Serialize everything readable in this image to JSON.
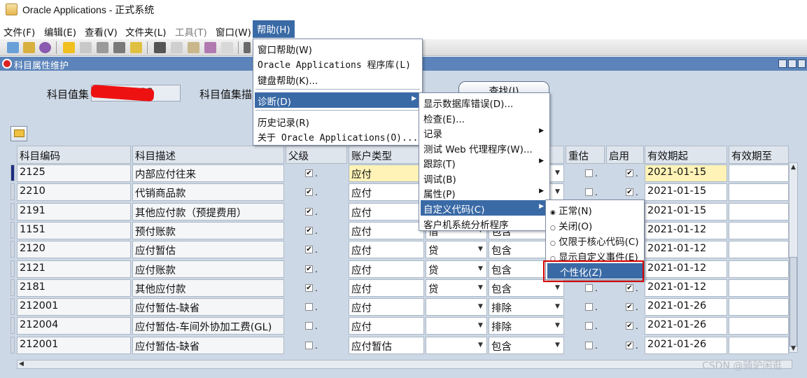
{
  "window": {
    "title": "Oracle Applications - 正式系统"
  },
  "menubar": {
    "items": [
      {
        "label": "文件(F)",
        "enabled": true
      },
      {
        "label": "编辑(E)",
        "enabled": true
      },
      {
        "label": "查看(V)",
        "enabled": true
      },
      {
        "label": "文件夹(L)",
        "enabled": true
      },
      {
        "label": "工具(T)",
        "enabled": false
      },
      {
        "label": "窗口(W)",
        "enabled": true
      },
      {
        "label": "帮助(H)",
        "enabled": true,
        "open": true
      }
    ]
  },
  "form": {
    "title": "科目属性维护",
    "value_set_label": "科目值集",
    "value_set_value": "ACC",
    "value_set_desc_label": "科目值集描",
    "find_label": "查找(I)"
  },
  "grid": {
    "headers": [
      "科目编码",
      "科目描述",
      "父级",
      "账户类型",
      "",
      "",
      "重估",
      "启用",
      "有效期起",
      "有效期至"
    ],
    "rows": [
      {
        "code": "2125",
        "desc": "内部应付往来",
        "parent": true,
        "type": "应付",
        "dc": "",
        "inc": "",
        "reval": false,
        "enabled": true,
        "start": "2021-01-15",
        "end": ""
      },
      {
        "code": "2210",
        "desc": "代销商品款",
        "parent": true,
        "type": "应付",
        "dc": "",
        "inc": "",
        "reval": false,
        "enabled": true,
        "start": "2021-01-15",
        "end": ""
      },
      {
        "code": "2191",
        "desc": "其他应付款（预提费用）",
        "parent": true,
        "type": "应付",
        "dc": "",
        "inc": "",
        "reval": false,
        "enabled": true,
        "start": "2021-01-15",
        "end": ""
      },
      {
        "code": "1151",
        "desc": "预付账款",
        "parent": true,
        "type": "应付",
        "dc": "借",
        "inc": "包含",
        "reval": false,
        "enabled": true,
        "start": "2021-01-12",
        "end": ""
      },
      {
        "code": "2120",
        "desc": "应付暂估",
        "parent": true,
        "type": "应付",
        "dc": "贷",
        "inc": "包含",
        "reval": false,
        "enabled": true,
        "start": "2021-01-12",
        "end": ""
      },
      {
        "code": "2121",
        "desc": "应付账款",
        "parent": true,
        "type": "应付",
        "dc": "贷",
        "inc": "包含",
        "reval": false,
        "enabled": true,
        "start": "2021-01-12",
        "end": ""
      },
      {
        "code": "2181",
        "desc": "其他应付款",
        "parent": true,
        "type": "应付",
        "dc": "贷",
        "inc": "包含",
        "reval": false,
        "enabled": true,
        "start": "2021-01-12",
        "end": ""
      },
      {
        "code": "212001",
        "desc": "应付暂估-缺省",
        "parent": false,
        "type": "应付",
        "dc": "",
        "inc": "排除",
        "reval": false,
        "enabled": true,
        "start": "2021-01-26",
        "end": ""
      },
      {
        "code": "212004",
        "desc": "应付暂估-车间外协加工费(GL)",
        "parent": false,
        "type": "应付",
        "dc": "",
        "inc": "排除",
        "reval": false,
        "enabled": true,
        "start": "2021-01-26",
        "end": ""
      },
      {
        "code": "212001",
        "desc": "应付暂估-缺省",
        "parent": false,
        "type": "应付暂估",
        "dc": "",
        "inc": "包含",
        "reval": false,
        "enabled": true,
        "start": "2021-01-26",
        "end": ""
      }
    ]
  },
  "help_menu": {
    "items": [
      "窗口帮助(W)",
      "Oracle Applications 程序库(L)",
      "键盘帮助(K)...",
      "诊断(D)",
      "历史记录(R)",
      "关于 Oracle Applications(O)..."
    ]
  },
  "diag_menu": {
    "items": [
      "显示数据库错误(D)...",
      "检查(E)...",
      "记录",
      "测试 Web 代理程序(W)...",
      "跟踪(T)",
      "调试(B)",
      "属性(P)",
      "自定义代码(C)",
      "客户机系统分析程序"
    ]
  },
  "custom_menu": {
    "items": [
      "正常(N)",
      "关闭(O)",
      "仅限于核心代码(C)",
      "显示自定义事件(E)",
      "个性化(Z)"
    ]
  },
  "watermark": "CSDN @骑驴闲逛"
}
